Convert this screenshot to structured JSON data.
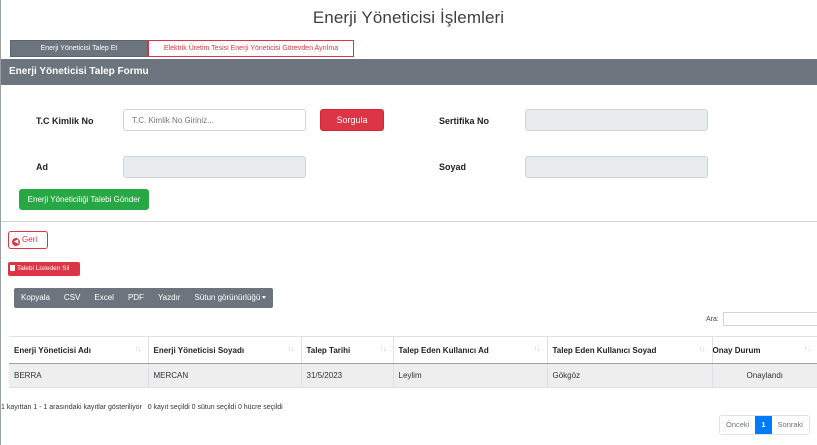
{
  "page": {
    "title": "Enerji Yöneticisi İşlemleri"
  },
  "tabs": [
    {
      "label": "Enerji Yöneticisi Talep Et"
    },
    {
      "label": "Elektrik Üretim Tesisi Enerji Yöneticisi Görevden Ayrılma"
    }
  ],
  "form": {
    "header": "Enerji Yöneticisi Talep Formu",
    "tc_label": "T.C Kimlik No",
    "tc_placeholder": "T.C. Kimlik No Giriniz...",
    "query_button": "Sorgula",
    "cert_label": "Sertifika No",
    "name_label": "Ad",
    "surname_label": "Soyad",
    "submit_button": "Enerji Yöneticiliği Talebi Gönder"
  },
  "actions": {
    "back_button": "Geri",
    "remove_button": "Talebi Listeden Sil"
  },
  "toolbar": {
    "buttons": [
      "Kopyala",
      "CSV",
      "Excel",
      "PDF",
      "Yazdır",
      "Sütun görünürlüğü"
    ]
  },
  "search": {
    "label": "Ara:"
  },
  "table": {
    "headers": [
      "Enerji Yöneticisi Adı",
      "Enerji Yöneticisi Soyadı",
      "Talep Tarihi",
      "Talep Eden Kullanıcı Ad",
      "Talep Eden Kullanıcı Soyad",
      "Onay Durum"
    ],
    "rows": [
      [
        "BERRA",
        "MERCAN",
        "31/5/2023",
        "Leylim",
        "Gökgöz",
        "Onaylandı"
      ]
    ]
  },
  "info": {
    "text": "1 kayıttan 1 - 1 arasındaki kayıtlar gösteriliyor",
    "selection": "0 kayıt seçildi  0 sütun seçildi  0 hücre seçildi"
  },
  "pagination": {
    "prev": "Önceki",
    "current": "1",
    "next": "Sonraki"
  },
  "colors": {
    "header_gray": "#6c757d",
    "danger": "#dc3545",
    "success": "#28a745",
    "primary": "#007bff"
  },
  "icons": {
    "back": "arrow-left-circle-icon",
    "remove": "trash-icon",
    "sort": "sort-icon",
    "dropdown": "caret-down-icon"
  }
}
